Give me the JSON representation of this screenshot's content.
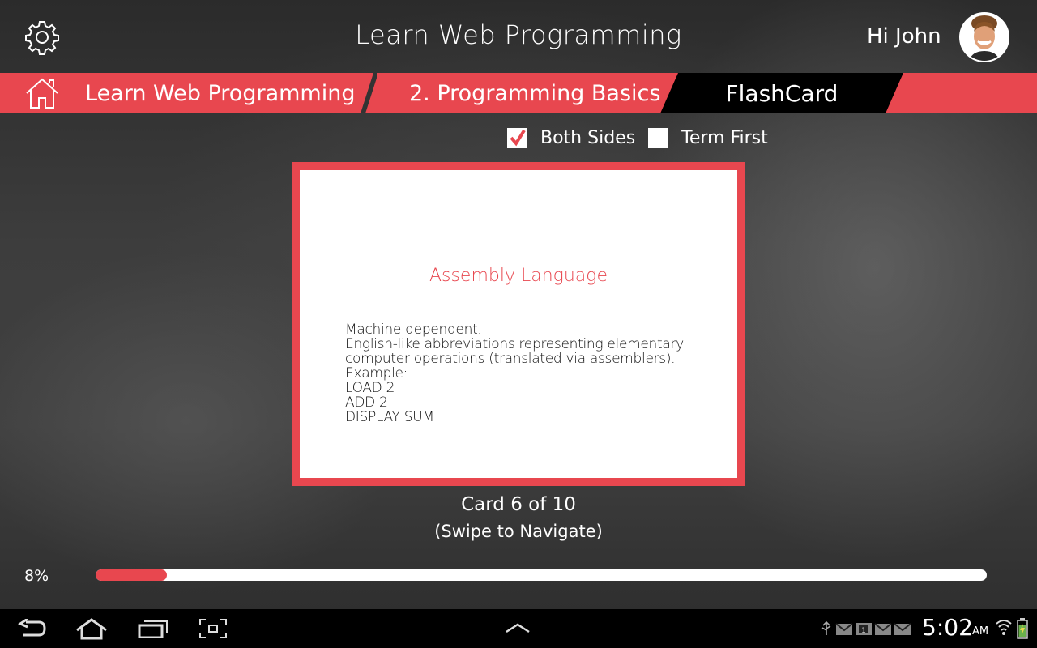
{
  "header": {
    "title": "Learn Web Programming",
    "greeting": "Hi John",
    "settings_icon": "gear-icon",
    "avatar": "user-avatar"
  },
  "breadcrumb": {
    "home_icon": "home-icon",
    "items": [
      {
        "label": "Learn Web Programming"
      },
      {
        "label": "2. Programming Basics"
      },
      {
        "label": "FlashCard",
        "active": true
      }
    ]
  },
  "options": {
    "both_sides": {
      "label": "Both Sides",
      "checked": true
    },
    "term_first": {
      "label": "Term First",
      "checked": false
    }
  },
  "card": {
    "term": "Assembly Language",
    "definition": "Machine dependent.\nEnglish-like abbreviations representing elementary\ncomputer operations (translated via assemblers).\nExample:\nLOAD 2\nADD 2\nDISPLAY SUM",
    "counter": "Card 6 of 10",
    "hint": "(Swipe to Navigate)"
  },
  "progress": {
    "label": "8%",
    "value": 0.08
  },
  "system_bar": {
    "buttons": [
      "back",
      "home",
      "recent-apps",
      "screenshot",
      "menu-up"
    ],
    "time": "5:02",
    "ampm": "AM",
    "status_icons": [
      "usb-icon",
      "gmail-icon",
      "calendar-icon",
      "gmail-icon",
      "gmail-icon",
      "wifi-icon",
      "battery-icon"
    ],
    "calendar_day": "1"
  },
  "colors": {
    "accent": "#e8474f",
    "active_crumb": "#000000"
  }
}
